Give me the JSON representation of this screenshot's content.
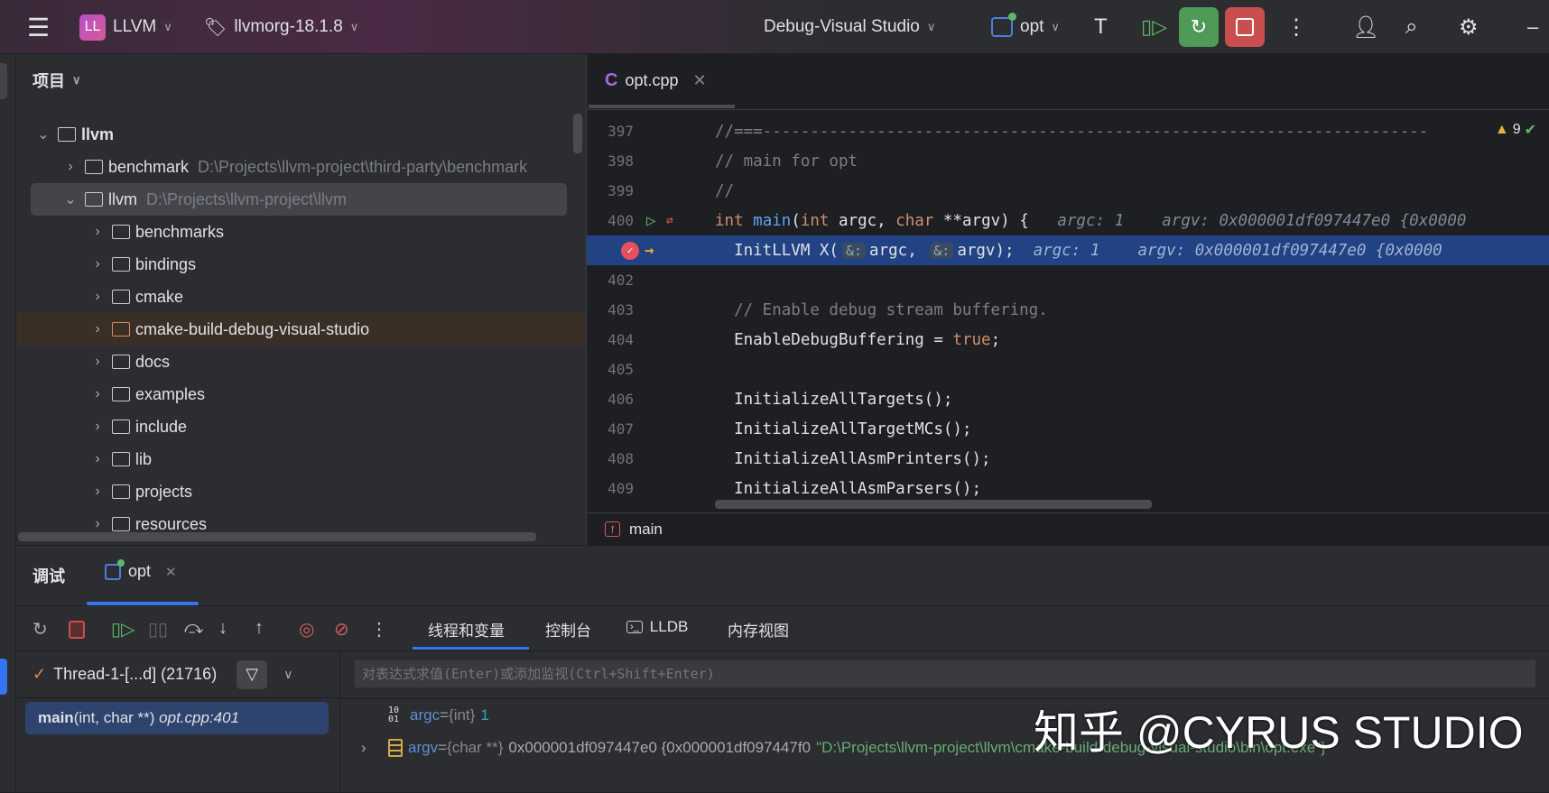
{
  "titlebar": {
    "project_badge": "LL",
    "project": "LLVM",
    "branch": "llvmorg-18.1.8",
    "config": "Debug-Visual Studio",
    "run_target": "opt"
  },
  "project_panel": {
    "title": "项目",
    "tree": [
      {
        "name": "llvm",
        "path": "",
        "level": 0,
        "expanded": true
      },
      {
        "name": "benchmark",
        "path": "D:\\Projects\\llvm-project\\third-party\\benchmark",
        "level": 1,
        "expanded": false
      },
      {
        "name": "llvm",
        "path": "D:\\Projects\\llvm-project\\llvm",
        "level": 1,
        "expanded": true
      },
      {
        "name": "benchmarks",
        "path": "",
        "level": 2
      },
      {
        "name": "bindings",
        "path": "",
        "level": 2
      },
      {
        "name": "cmake",
        "path": "",
        "level": 2
      },
      {
        "name": "cmake-build-debug-visual-studio",
        "path": "",
        "level": 2
      },
      {
        "name": "docs",
        "path": "",
        "level": 2
      },
      {
        "name": "examples",
        "path": "",
        "level": 2
      },
      {
        "name": "include",
        "path": "",
        "level": 2
      },
      {
        "name": "lib",
        "path": "",
        "level": 2
      },
      {
        "name": "projects",
        "path": "",
        "level": 2
      },
      {
        "name": "resources",
        "path": "",
        "level": 2
      }
    ]
  },
  "editor": {
    "tab": "opt.cpp",
    "warnings": "9",
    "breadcrumb": "main",
    "lines": [
      {
        "n": "397",
        "code": "//===----------------------------------------------------------------------"
      },
      {
        "n": "398",
        "code": "// main for opt"
      },
      {
        "n": "399",
        "code": "//"
      },
      {
        "n": "400",
        "kw1": "int",
        "fn": "main",
        "p1": "(",
        "kw2": "int",
        "p2": " argc, ",
        "kw3": "char",
        "p3": " **argv) {",
        "hint": "argc: 1    argv: 0x000001df097447e0 {0x0000"
      },
      {
        "n": "401",
        "a": "InitLLVM X(",
        "amp": "&:",
        "b": "argc, ",
        "c": "argv);",
        "hint": "argc: 1    argv: 0x000001df097447e0 {0x0000"
      },
      {
        "n": "402",
        "code": ""
      },
      {
        "n": "403",
        "code": "  // Enable debug stream buffering."
      },
      {
        "n": "404",
        "a": "  EnableDebugBuffering = ",
        "kw": "true",
        ";": ";"
      },
      {
        "n": "405",
        "code": ""
      },
      {
        "n": "406",
        "code": "  InitializeAllTargets();"
      },
      {
        "n": "407",
        "code": "  InitializeAllTargetMCs();"
      },
      {
        "n": "408",
        "code": "  InitializeAllAsmPrinters();"
      },
      {
        "n": "409",
        "code": "  InitializeAllAsmParsers();"
      }
    ]
  },
  "debug": {
    "title": "调试",
    "session": "opt",
    "tabs": [
      "线程和变量",
      "控制台",
      "LLDB",
      "内存视图"
    ],
    "thread": "Thread-1-[...d] (21716)",
    "frame_fn": "main",
    "frame_args": "(int, char **)",
    "frame_loc": "opt.cpp:401",
    "eval_placeholder": "对表达式求值(Enter)或添加监视(Ctrl+Shift+Enter)",
    "vars": [
      {
        "name": "argc",
        "eq": " = ",
        "type": "{int}",
        "value": "1"
      },
      {
        "name": "argv",
        "eq": " = ",
        "type": "{char **}",
        "value": "0x000001df097447e0 {0x000001df097447f0",
        "str": "\"D:\\Projects\\llvm-project\\llvm\\cmake-build-debug-visual-studio\\bin\\opt.exe\"}"
      }
    ]
  },
  "watermark": "知乎 @CYRUS STUDIO"
}
